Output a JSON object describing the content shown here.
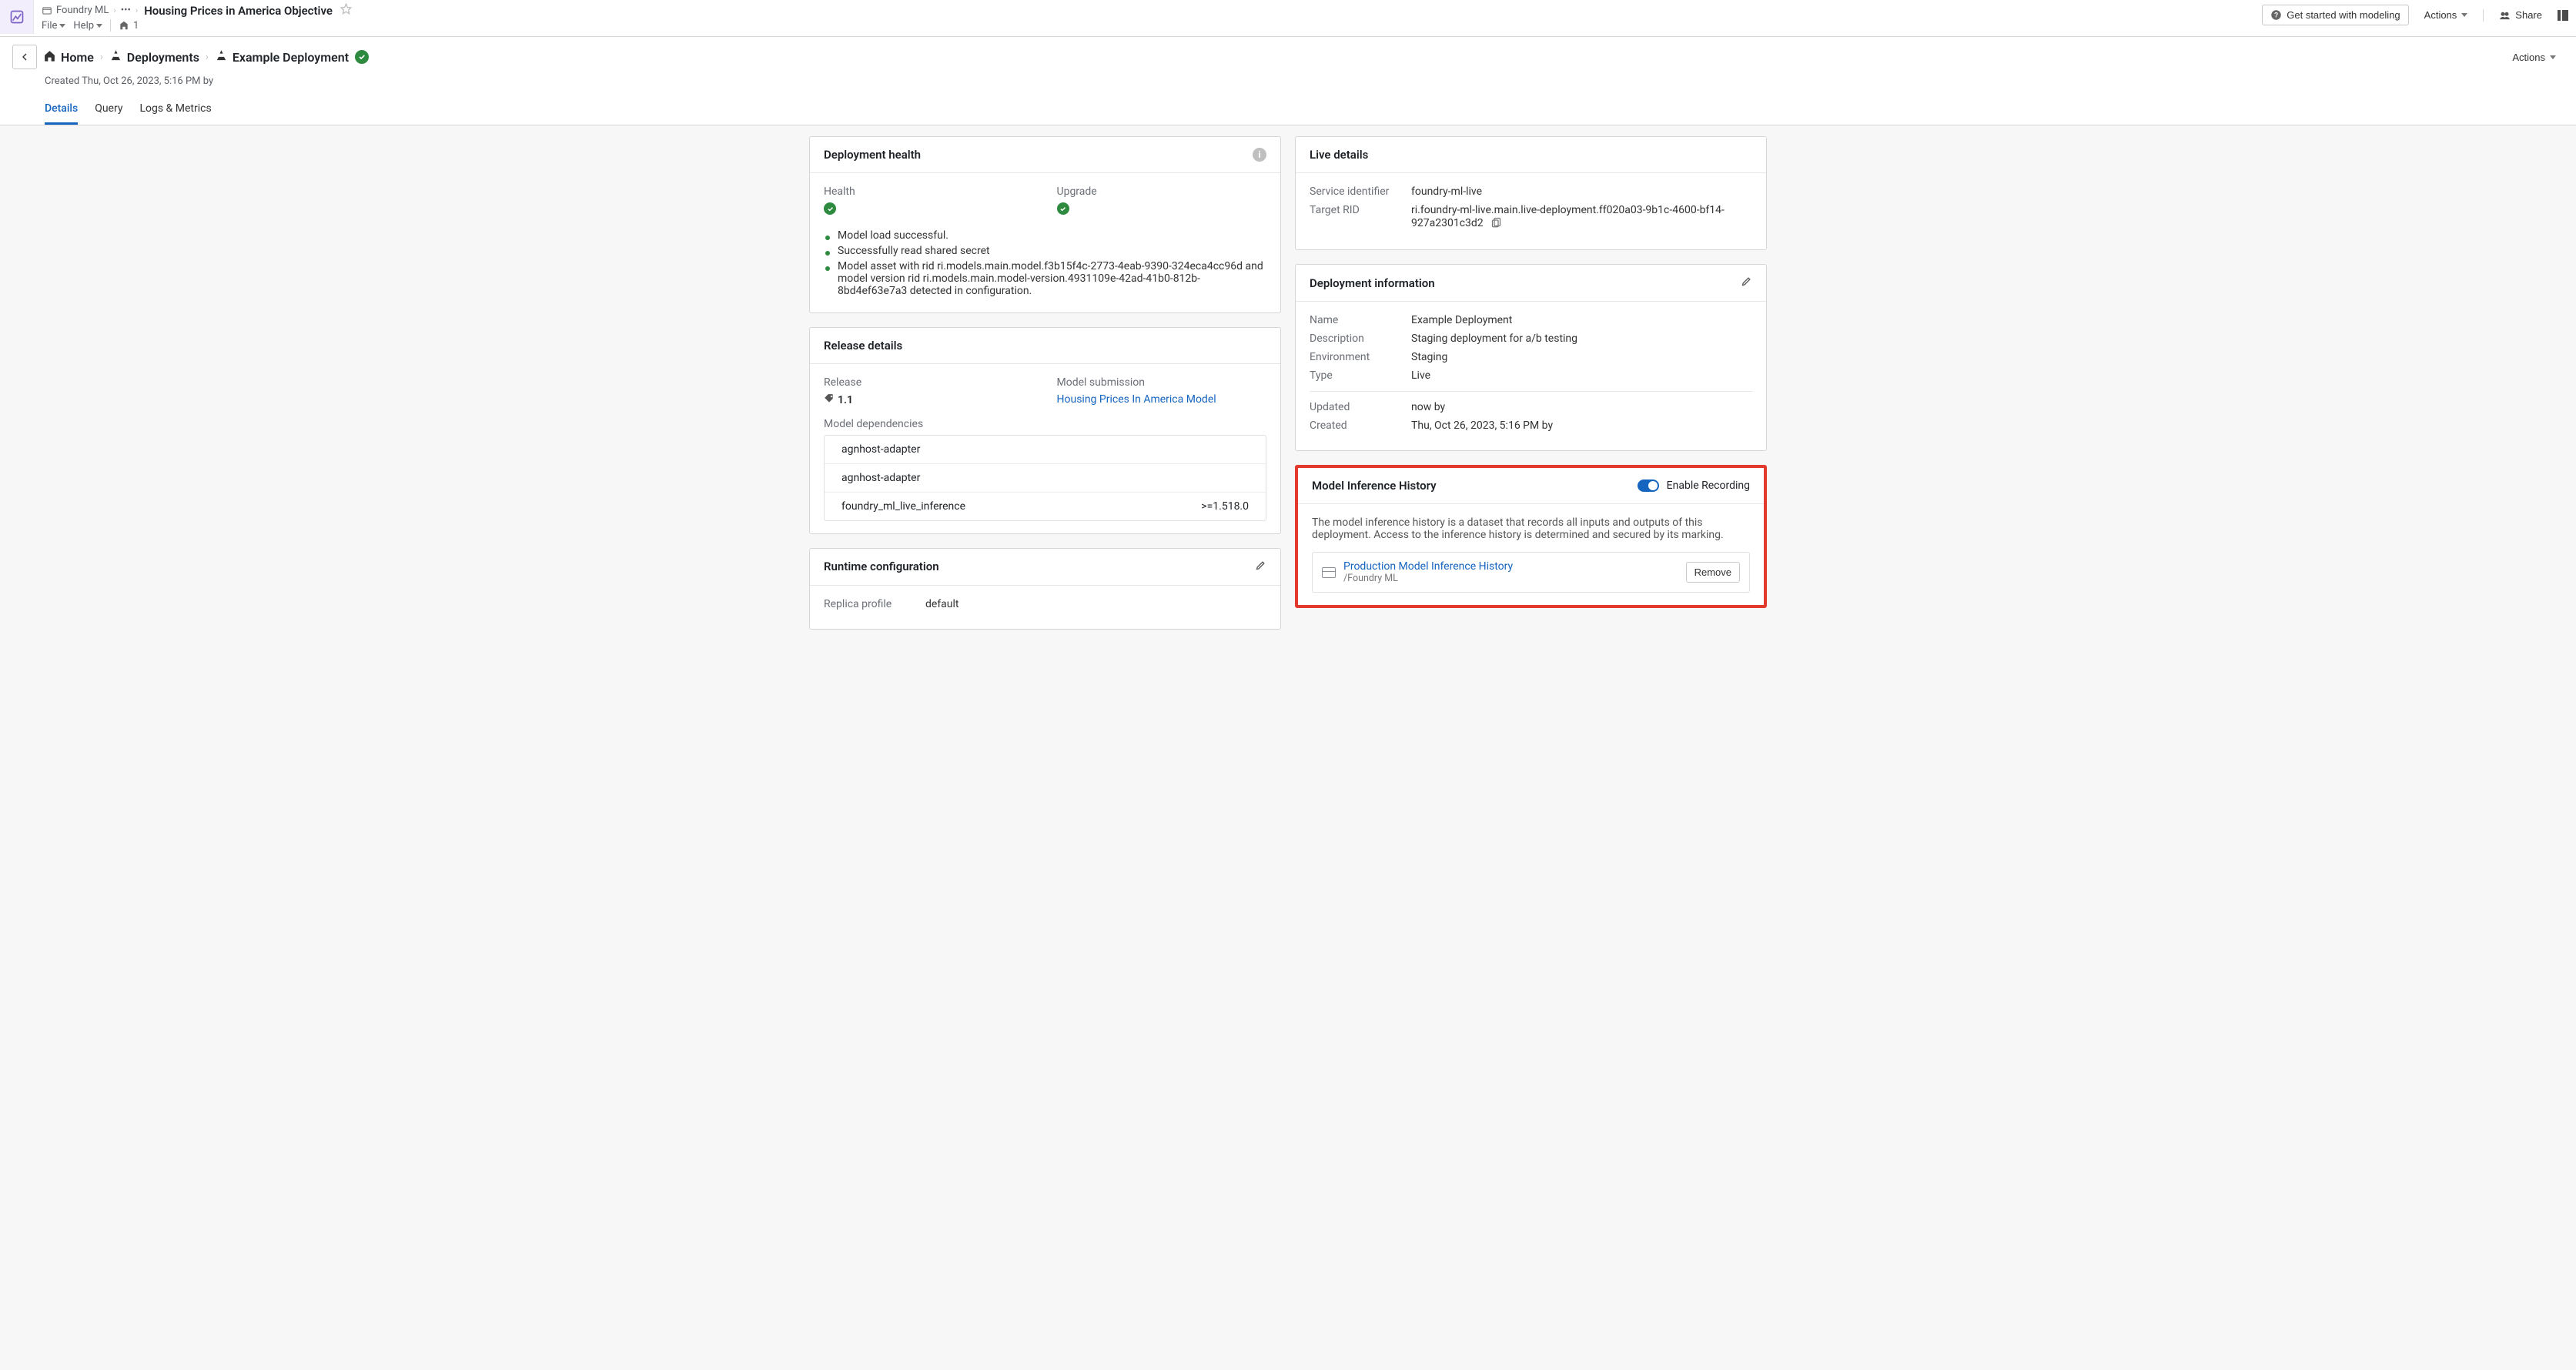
{
  "appbar": {
    "crumb_root": "Foundry ML",
    "ellipsis": "•••",
    "page_title": "Housing Prices in America Objective",
    "file_menu": "File",
    "help_menu": "Help",
    "collab_count": "1",
    "get_started": "Get started with modeling",
    "actions": "Actions",
    "share": "Share"
  },
  "pagehead": {
    "home": "Home",
    "deployments": "Deployments",
    "current": "Example Deployment",
    "created_line": "Created Thu, Oct 26, 2023, 5:16 PM by",
    "tabs": {
      "details": "Details",
      "query": "Query",
      "logs": "Logs & Metrics"
    },
    "actions": "Actions"
  },
  "health": {
    "title": "Deployment health",
    "label_health": "Health",
    "label_upgrade": "Upgrade",
    "items": [
      "Model load successful.",
      "Successfully read shared secret",
      "Model asset with rid ri.models.main.model.f3b15f4c-2773-4eab-9390-324eca4cc96d and model version rid ri.models.main.model-version.4931109e-42ad-41b0-812b-8bd4ef63e7a3 detected in configuration."
    ]
  },
  "release": {
    "title": "Release details",
    "label_release": "Release",
    "release_version": "1.1",
    "label_submission": "Model submission",
    "submission_link": "Housing Prices In America Model",
    "label_deps": "Model dependencies",
    "deps": [
      {
        "name": "agnhost-adapter",
        "ver": ""
      },
      {
        "name": "agnhost-adapter",
        "ver": ""
      },
      {
        "name": "foundry_ml_live_inference",
        "ver": ">=1.518.0"
      }
    ]
  },
  "runtime": {
    "title": "Runtime configuration",
    "label_replica": "Replica profile",
    "replica_value": "default"
  },
  "live": {
    "title": "Live details",
    "label_service": "Service identifier",
    "service": "foundry-ml-live",
    "label_rid": "Target RID",
    "rid": "ri.foundry-ml-live.main.live-deployment.ff020a03-9b1c-4600-bf14-927a2301c3d2"
  },
  "info": {
    "title": "Deployment information",
    "label_name": "Name",
    "name": "Example Deployment",
    "label_desc": "Description",
    "desc": "Staging deployment for a/b testing",
    "label_env": "Environment",
    "env": "Staging",
    "label_type": "Type",
    "type": "Live",
    "label_updated": "Updated",
    "updated": "now by",
    "label_created": "Created",
    "created": "Thu, Oct 26, 2023, 5:16 PM by"
  },
  "history": {
    "title": "Model Inference History",
    "toggle_label": "Enable Recording",
    "body": "The model inference history is a dataset that records all inputs and outputs of this deployment. Access to the inference history is determined and secured by its marking.",
    "link_label": "Production Model Inference History",
    "link_sub": "/Foundry ML",
    "remove": "Remove"
  }
}
